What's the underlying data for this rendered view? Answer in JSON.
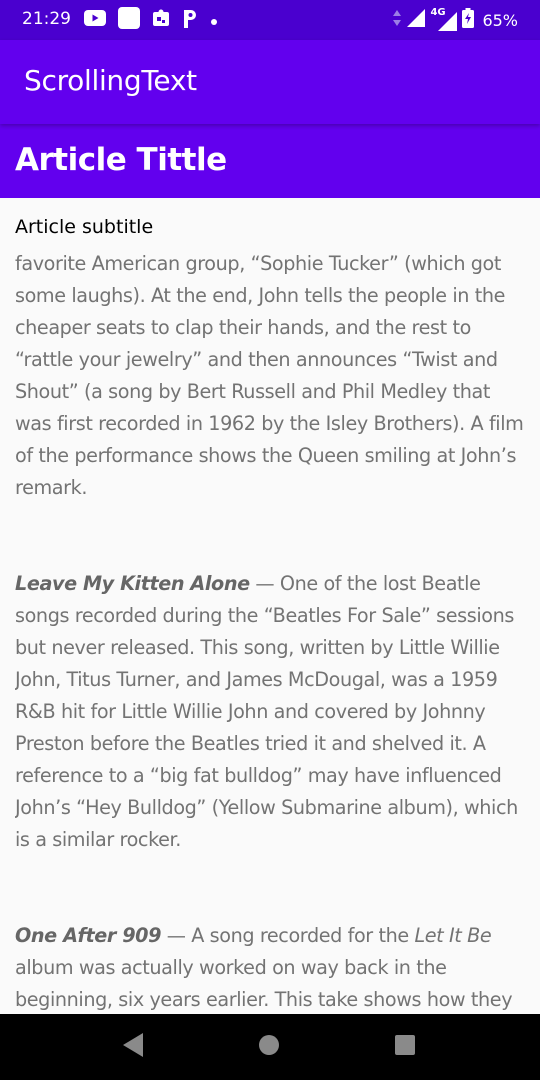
{
  "status_bar": {
    "time": "21:29",
    "network": "4G",
    "battery": "65%",
    "colors": {
      "background": "#4a00cf",
      "foreground": "#ffffff"
    },
    "icons_left": [
      "youtube-icon",
      "app-square-icon",
      "puzzle-app-icon",
      "parking-p-icon",
      "notification-dot-icon"
    ],
    "icons_right": [
      "data-arrows-icon",
      "signal-icon",
      "signal-4g-icon",
      "battery-icon"
    ]
  },
  "app_bar": {
    "title": "ScrollingText",
    "color": "#6200ee"
  },
  "article": {
    "title": "Article Tittle",
    "subtitle": "Article subtitle",
    "paragraphs": [
      {
        "text": "favorite American group, “Sophie Tucker” (which got some laughs). At the end, John tells the people in the cheaper seats to clap their hands, and the rest to “rattle your jewelry” and then announces “Twist and Shout” (a song by Bert Russell and Phil Medley that was first recorded in 1962 by the Isley Brothers). A film of the performance shows the Queen smiling at John’s remark."
      },
      {
        "song": "Leave My Kitten Alone",
        "text": " — One of the lost Beatle songs recorded during the “Beatles For Sale” sessions but never released. This song, written by Little Willie John, Titus Turner, and James McDougal, was a 1959 R&B hit for Little Willie John and covered by Johnny Preston before the Beatles tried it and shelved it. A reference to a “big fat bulldog” may have influenced John’s “Hey Bulldog” (Yellow Submarine album), which is a similar rocker."
      },
      {
        "song": "One After 909",
        "text_before": " — A song recorded for the ",
        "album": "Let It Be",
        "text_after": " album was actually worked on way back in the beginning, six years earlier. This take shows how they did it much more slowly, with an R&B feel to it."
      }
    ],
    "colors": {
      "body_text": "#737373",
      "subtitle": "#000000"
    }
  },
  "nav_bar": {
    "buttons": [
      "back-triangle-icon",
      "home-circle-icon",
      "recents-square-icon"
    ]
  }
}
